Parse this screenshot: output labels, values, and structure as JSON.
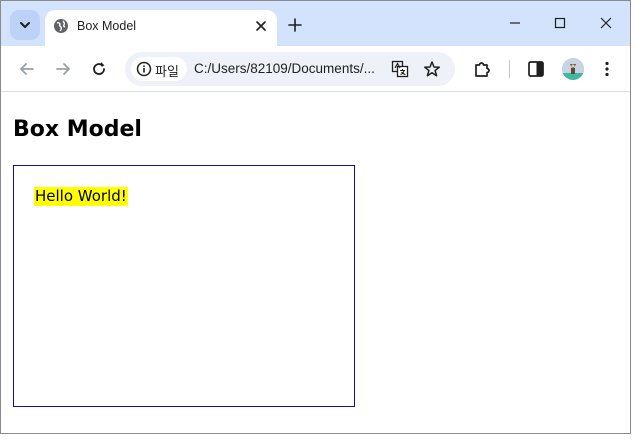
{
  "browser": {
    "tab": {
      "title": "Box Model"
    },
    "omnibox": {
      "chip_label": "파일",
      "url": "C:/Users/82109/Documents/..."
    }
  },
  "icons": {
    "tab_search": "chevron-down-icon",
    "tab_favicon": "globe-icon",
    "tab_close": "close-icon",
    "new_tab": "plus-icon",
    "minimize": "minimize-icon",
    "maximize": "maximize-icon",
    "close_window": "close-icon",
    "back": "back-arrow-icon",
    "forward": "forward-arrow-icon",
    "reload": "reload-icon",
    "site_info": "info-icon",
    "translate": "translate-icon",
    "bookmark": "star-icon",
    "extensions": "puzzle-icon",
    "side_panel": "side-panel-icon",
    "menu": "kebab-menu-icon"
  },
  "colors": {
    "titlebar": "#d3e3fd",
    "box_border": "#1010a8",
    "highlight": "#ffff00"
  },
  "page": {
    "heading": "Box Model",
    "box_text": "Hello World!"
  }
}
